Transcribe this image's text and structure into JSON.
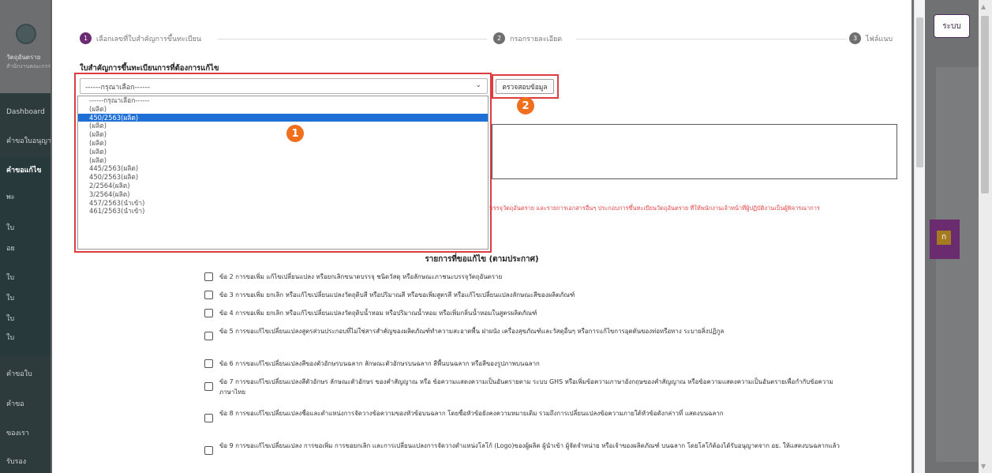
{
  "background": {
    "site_name": "วัตถุอันตราย",
    "site_subtitle": "สำนักงานคณะกรรมการอาหารและยา",
    "nav_items": [
      "Dashboard",
      "คำขอใบอนุญาต",
      "คำขอแก้ไข",
      "พะ",
      "ใบ",
      "อย",
      "ใบ",
      "ใบ",
      "ใบ",
      "ใบ",
      "คำขอใบ",
      "คำขอ",
      "ของเรา",
      "รับรอง"
    ],
    "right_button": "ระบบ",
    "right_badge": "ก"
  },
  "stepper": {
    "steps": [
      {
        "num": "1",
        "label": "เลือกเลขที่ใบสำคัญการขึ้นทะเบียน",
        "color": "#6b2b73"
      },
      {
        "num": "2",
        "label": "กรอกรายละเอียด",
        "color": "#6f6f6f"
      },
      {
        "num": "3",
        "label": "ไฟล์แนบ",
        "color": "#6f6f6f"
      }
    ]
  },
  "form": {
    "field_label": "ใบสำคัญการขึ้นทะเบียนการที่ต้องการแก้ไข",
    "select_value": "------กรุณาเลือก------",
    "options": [
      "------กรุณาเลือก------",
      "(ผลิต)",
      "450/2563(ผลิต)",
      "(ผลิต)",
      "(ผลิต)",
      "(ผลิต)",
      "(ผลิต)",
      "(ผลิต)",
      "445/2563(ผลิต)",
      "450/2563(ผลิต)",
      "2/2564(ผลิต)",
      "3/2564(ผลิต)",
      "457/2563(นำเข้า)",
      "461/2563(นำเข้า)"
    ],
    "selected_index": 2,
    "check_button": "ตรวจสอบข้อมูล",
    "red_note": "บรรจุวัตถุอันตราย และรายการเอกสารอื่นๆ ประกอบการขึ้นทะเบียนวัตถุอันตราย ที่ให้พนักงานเจ้าหน้าที่ผู้ปฏิบัติงานเป็นผู้พิจารณาการ"
  },
  "callouts": {
    "one": "1",
    "two": "2"
  },
  "section_title": "รายการที่ขอแก้ไข (ตามประกาศ)",
  "checklist": [
    {
      "text": "ข้อ 2 การขอเพิ่ม แก้ไขเปลี่ยนแปลง หรือยกเลิกขนาดบรรจุ ชนิดวัสดุ หรือลักษณะภาชนะบรรจุวัตถุอันตราย",
      "checked": false
    },
    {
      "text": "ข้อ 3 การขอเพิ่ม ยกเลิก หรือแก้ไขเปลี่ยนแปลงวัตถุดิบสี หรือปริมาณสี หรือขอเพิ่มสูตรสี หรือแก้ไขเปลี่ยนแปลงลักษณะสีของผลิตภัณฑ์",
      "checked": false
    },
    {
      "text": "ข้อ 4 การขอเพิ่ม ยกเลิก หรือแก้ไขเปลี่ยนแปลงวัตถุดิบน้ำหอม หรือปริมาณน้ำหอม หรือเพิ่มกลิ่นน้ำหอมในสูตรผลิตภัณฑ์",
      "checked": false
    },
    {
      "text": "ข้อ 5 การขอแก้ไขเปลี่ยนแปลงสูตรส่วนประกอบที่ไม่ใช่สารสำคัญของผลิตภัณฑ์ทำความสะอาดพื้น ฝาผนัง เครื่องสุขภัณฑ์และวัสดุอื่นๆ หรือการแก้ไขการอุดตันของท่อหรือทาง ระบายสิ่งปฏิกูล",
      "checked": false
    },
    {
      "text": "ข้อ 6 การขอแก้ไขเปลี่ยนแปลงสีของตัวอักษรบนฉลาก ลักษณะตัวอักษรบนฉลาก สีพื้นบนฉลาก หรือสีของรูปภาพบนฉลาก",
      "checked": false
    },
    {
      "text": "ข้อ 7 การขอแก้ไขเปลี่ยนแปลงสีตัวอักษร ลักษณะตัวอักษร ของคำสัญญาณ หรือ ข้อความแสดงความเป็นอันตรายตาม ระบบ GHS หรือเพิ่มข้อความภาษาอังกฤษของคำสัญญาณ หรือข้อความแสดงความเป็นอันตรายเพื่อกำกับข้อความภาษาไทย",
      "checked": false
    },
    {
      "text": "ข้อ 8 การขอแก้ไขเปลี่ยนแปลงชื่อและตำแหน่งการจัดวางข้อความของหัวข้อบนฉลาก โดยชื่อหัวข้อยังคงความหมายเดิม รวมถึงการเปลี่ยนแปลงข้อความภายใต้หัวข้อดังกล่าวที่ แสดงบนฉลาก",
      "checked": false
    },
    {
      "text": "ข้อ 9 การขอแก้ไขเปลี่ยนแปลง การขอเพิ่ม การขอยกเลิก และการเปลี่ยนแปลงการจัดวางตำแหน่งโลโก้ (Logo)ของผู้ผลิต ผู้นำเข้า ผู้จัดจำหน่าย หรือเจ้าของผลิตภัณฑ์ บนฉลาก โดยโลโก้ต้องได้รับอนุญาตจาก อย. ให้แสดงบนฉลากแล้ว",
      "checked": false
    }
  ],
  "colors": {
    "accent": "#6b2b73",
    "highlight": "#dd3c40",
    "callout": "#f06f1d",
    "selection": "#1e6fd6",
    "note": "#e04747"
  }
}
